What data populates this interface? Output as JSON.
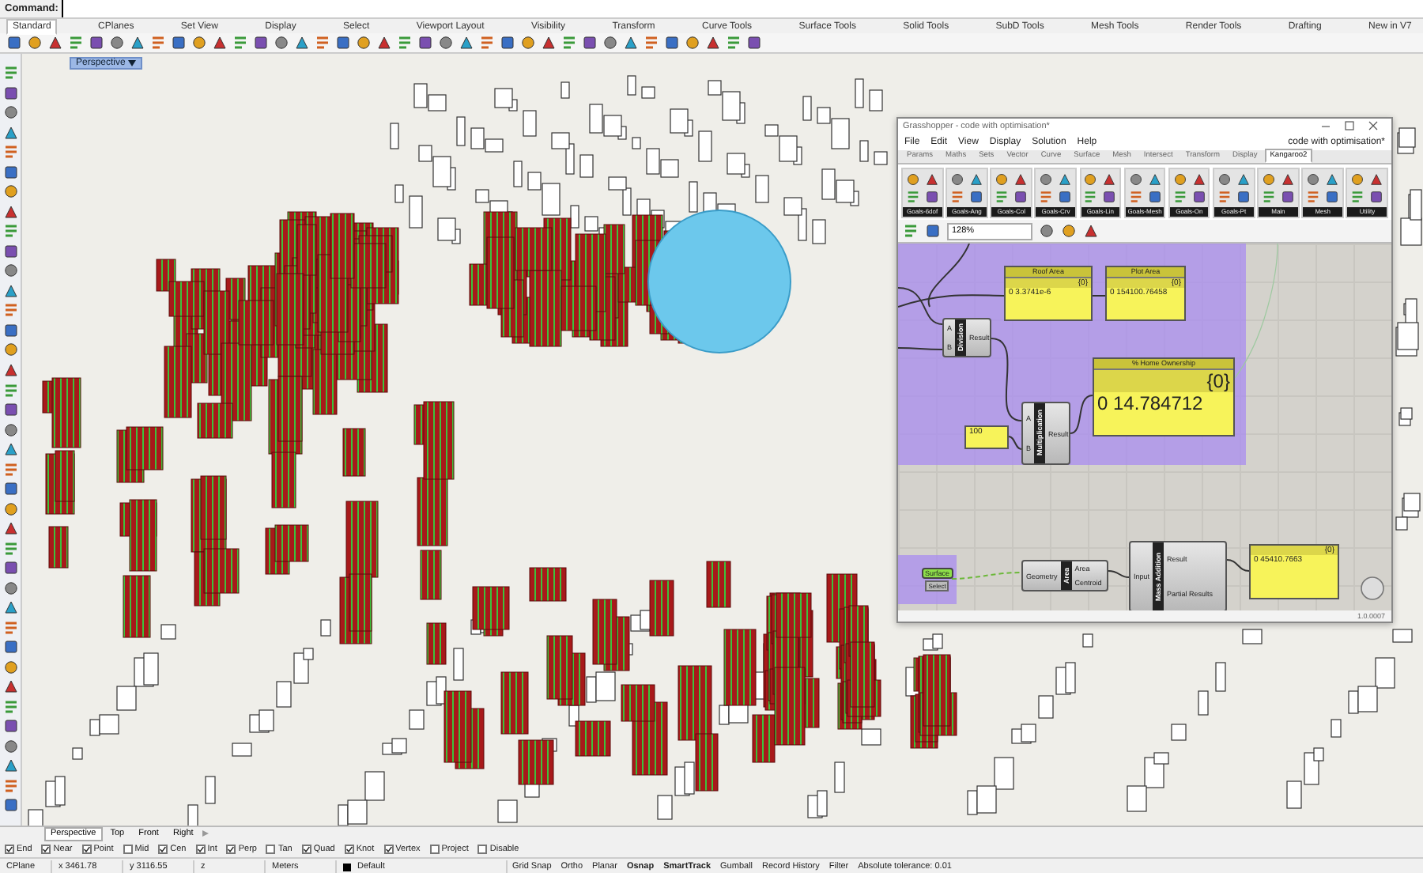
{
  "command_line": {
    "label": "Command:"
  },
  "toolbar_tabs": [
    {
      "label": "Standard",
      "selected": true
    },
    {
      "label": "CPlanes",
      "selected": false
    },
    {
      "label": "Set View",
      "selected": false
    },
    {
      "label": "Display",
      "selected": false
    },
    {
      "label": "Select",
      "selected": false
    },
    {
      "label": "Viewport Layout",
      "selected": false
    },
    {
      "label": "Visibility",
      "selected": false
    },
    {
      "label": "Transform",
      "selected": false
    },
    {
      "label": "Curve Tools",
      "selected": false
    },
    {
      "label": "Surface Tools",
      "selected": false
    },
    {
      "label": "Solid Tools",
      "selected": false
    },
    {
      "label": "SubD Tools",
      "selected": false
    },
    {
      "label": "Mesh Tools",
      "selected": false
    },
    {
      "label": "Render Tools",
      "selected": false
    },
    {
      "label": "Drafting",
      "selected": false
    },
    {
      "label": "New in V7",
      "selected": false
    }
  ],
  "viewport": {
    "label": "Perspective"
  },
  "grasshopper": {
    "title": "Grasshopper - code with optimisation*",
    "menu": [
      "File",
      "Edit",
      "View",
      "Display",
      "Solution",
      "Help"
    ],
    "document_name": "code with optimisation*",
    "tabs": [
      {
        "label": "Params",
        "selected": false
      },
      {
        "label": "Maths",
        "selected": false
      },
      {
        "label": "Sets",
        "selected": false
      },
      {
        "label": "Vector",
        "selected": false
      },
      {
        "label": "Curve",
        "selected": false
      },
      {
        "label": "Surface",
        "selected": false
      },
      {
        "label": "Mesh",
        "selected": false
      },
      {
        "label": "Intersect",
        "selected": false
      },
      {
        "label": "Transform",
        "selected": false
      },
      {
        "label": "Display",
        "selected": false
      },
      {
        "label": "Kangaroo2",
        "selected": true
      }
    ],
    "groups": [
      "Goals-6dof",
      "Goals-Ang",
      "Goals-Col",
      "Goals-Crv",
      "Goals-Lin",
      "Goals-Mesh",
      "Goals-On",
      "Goals-Pt",
      "Main",
      "Mesh",
      "Utility"
    ],
    "zoom": "128%",
    "nodes": [
      {
        "kind": "panel",
        "title": "Roof Area",
        "path": "{0}",
        "value": "0 3.3741e-6"
      },
      {
        "kind": "panel",
        "title": "Plot Area",
        "path": "{0}",
        "value": "0 154100.76458"
      },
      {
        "kind": "component",
        "name": "Division",
        "inputs": [
          "A",
          "B"
        ],
        "outputs": [
          "Result"
        ]
      },
      {
        "kind": "panel",
        "title": "% Home Ownership",
        "path": "{0}",
        "value": "0 14.784712"
      },
      {
        "kind": "component",
        "name": "Multiplication",
        "inputs": [
          "A",
          "B"
        ],
        "outputs": [
          "Result"
        ]
      },
      {
        "kind": "panel",
        "value": "100"
      },
      {
        "kind": "param",
        "name": "Surface",
        "sub": "Select"
      },
      {
        "kind": "component",
        "name": "Area",
        "inputs": [
          "Geometry"
        ],
        "outputs": [
          "Area",
          "Centroid"
        ]
      },
      {
        "kind": "component",
        "name": "Mass Addition",
        "inputs": [
          "Input"
        ],
        "outputs": [
          "Result",
          "Partial Results"
        ]
      },
      {
        "kind": "panel",
        "path": "{0}",
        "value": "0 45410.7663"
      }
    ],
    "version": "1.0.0007"
  },
  "viewport_tabs": [
    {
      "label": "Perspective",
      "selected": true
    },
    {
      "label": "Top",
      "selected": false
    },
    {
      "label": "Front",
      "selected": false
    },
    {
      "label": "Right",
      "selected": false
    }
  ],
  "osnaps": [
    {
      "label": "End",
      "checked": true
    },
    {
      "label": "Near",
      "checked": true
    },
    {
      "label": "Point",
      "checked": true
    },
    {
      "label": "Mid",
      "checked": false
    },
    {
      "label": "Cen",
      "checked": true
    },
    {
      "label": "Int",
      "checked": true
    },
    {
      "label": "Perp",
      "checked": true
    },
    {
      "label": "Tan",
      "checked": false
    },
    {
      "label": "Quad",
      "checked": true
    },
    {
      "label": "Knot",
      "checked": true
    },
    {
      "label": "Vertex",
      "checked": true
    },
    {
      "label": "Project",
      "checked": false
    },
    {
      "label": "Disable",
      "checked": false
    }
  ],
  "status_bar": {
    "cplane": "CPlane",
    "x": "x 3461.78",
    "y": "y 3116.55",
    "z": "z",
    "units": "Meters",
    "layer": "Default",
    "toggles": [
      {
        "label": "Grid Snap",
        "on": false
      },
      {
        "label": "Ortho",
        "on": false
      },
      {
        "label": "Planar",
        "on": false
      },
      {
        "label": "Osnap",
        "on": true
      },
      {
        "label": "SmartTrack",
        "on": true
      },
      {
        "label": "Gumball",
        "on": false
      },
      {
        "label": "Record History",
        "on": false
      },
      {
        "label": "Filter",
        "on": false
      }
    ],
    "tolerance": "Absolute tolerance: 0.01"
  }
}
